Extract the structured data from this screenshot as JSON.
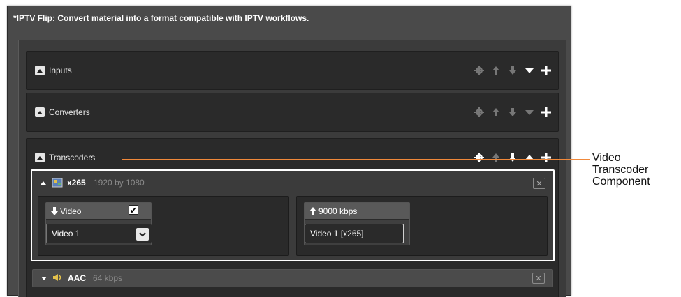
{
  "window": {
    "title": "*IPTV Flip: Convert material into a format compatible with IPTV workflows."
  },
  "sections": [
    {
      "label": "Inputs",
      "state": "expanded"
    },
    {
      "label": "Converters",
      "state": "expanded"
    },
    {
      "label": "Transcoders",
      "state": "expanded"
    }
  ],
  "component": {
    "name": "x265",
    "detail": "1920 by 1080",
    "input_card": {
      "label": "Video",
      "checked": true,
      "select_value": "Video 1"
    },
    "output_card": {
      "label": "9000 kbps",
      "field_value": "Video 1 [x265]"
    }
  },
  "aac_component": {
    "name": "AAC",
    "detail": "64 kbps"
  },
  "callout": {
    "line1": "Video",
    "line2": "Transcoder",
    "line3": "Component",
    "color": "#f0893b"
  },
  "icons": {
    "settings": "gear-icon",
    "move_up": "arrow-up-icon",
    "move_down": "arrow-down-icon",
    "collapse": "triangle-icon",
    "add": "plus-icon"
  }
}
